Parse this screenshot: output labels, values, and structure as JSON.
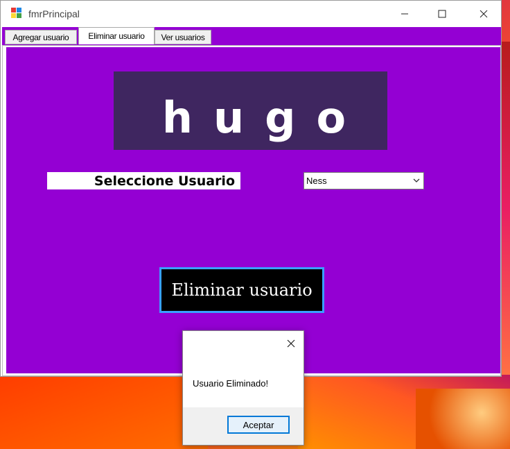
{
  "window": {
    "title": "fmrPrincipal"
  },
  "tabs": [
    {
      "label": "Agregar usuario",
      "selected": false
    },
    {
      "label": "Eliminar usuario",
      "selected": true
    },
    {
      "label": "Ver usuarios",
      "selected": false
    }
  ],
  "form": {
    "logo_text": "hugo",
    "select_label": "Seleccione Usuario",
    "user_combo_value": "Ness",
    "delete_button": "Eliminar usuario"
  },
  "message_box": {
    "text": "Usuario Eliminado!",
    "ok_button": "Aceptar"
  },
  "colors": {
    "form_background": "#9400d3",
    "logo_background": "#3f2660",
    "button_background": "#000000",
    "focus_border": "#0078d7"
  },
  "icons": {
    "app": "winforms-app-icon",
    "minimize": "minimize-icon",
    "maximize": "maximize-icon",
    "close": "close-icon",
    "combo_arrow": "chevron-down-icon",
    "dialog_close": "close-icon"
  }
}
